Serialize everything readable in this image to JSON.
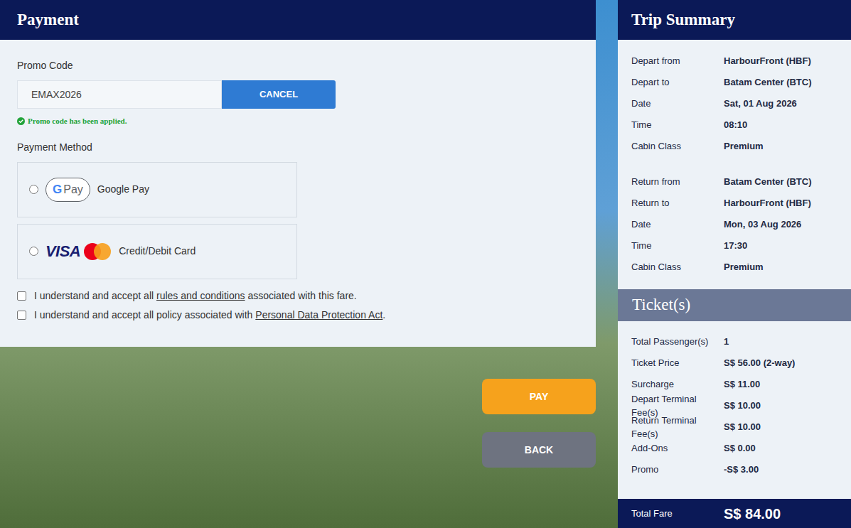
{
  "payment": {
    "title": "Payment",
    "promo": {
      "label": "Promo Code",
      "value": "EMAX2026",
      "button": "CANCEL",
      "status": "Promo code has been applied.",
      "applied": true
    },
    "method_label": "Payment Method",
    "methods": [
      {
        "kind": "gpay",
        "logo_mark": "G",
        "logo_text": "Pay",
        "label": "Google Pay",
        "selected": false
      },
      {
        "kind": "card",
        "logo_mark": "VISA",
        "logo_text": "",
        "label": "Credit/Debit Card",
        "selected": false
      }
    ],
    "agreements": [
      {
        "before": "I understand and accept all ",
        "link": "rules and conditions",
        "after": " associated with this fare.",
        "checked": false
      },
      {
        "before": "I understand and accept all policy associated with ",
        "link": "Personal Data Protection Act",
        "after": ".",
        "checked": false
      }
    ],
    "buttons": [
      {
        "label": "PAY",
        "color": "#f6a21c"
      },
      {
        "label": "BACK",
        "color": "#6e7380"
      }
    ]
  },
  "summary": {
    "title": "Trip Summary",
    "groups": [
      [
        {
          "label": "Depart from",
          "value": "HarbourFront (HBF)"
        },
        {
          "label": "Depart to",
          "value": "Batam Center (BTC)"
        },
        {
          "label": "Date",
          "value": "Sat, 01 Aug 2026"
        },
        {
          "label": "Time",
          "value": "08:10"
        },
        {
          "label": "Cabin Class",
          "value": "Premium"
        }
      ],
      [
        {
          "label": "Return from",
          "value": "Batam Center (BTC)"
        },
        {
          "label": "Return to",
          "value": "HarbourFront (HBF)"
        },
        {
          "label": "Date",
          "value": "Mon, 03 Aug 2026"
        },
        {
          "label": "Time",
          "value": "17:30"
        },
        {
          "label": "Cabin Class",
          "value": "Premium"
        }
      ]
    ]
  },
  "tickets": {
    "title": "Ticket(s)",
    "rows": [
      {
        "label": "Total Passenger(s)",
        "value": "1"
      },
      {
        "label": "Ticket Price",
        "value": "S$ 56.00 (2-way)"
      },
      {
        "label": "Surcharge",
        "value": "S$ 11.00"
      },
      {
        "label": "Depart Terminal Fee(s)",
        "value": "S$ 10.00"
      },
      {
        "label": "Return Terminal Fee(s)",
        "value": "S$ 10.00"
      },
      {
        "label": "Add-Ons",
        "value": "S$ 0.00"
      },
      {
        "label": "Promo",
        "value": "-S$ 3.00"
      }
    ]
  },
  "total": {
    "label": "Total Fare",
    "value": "S$ 84.00"
  }
}
